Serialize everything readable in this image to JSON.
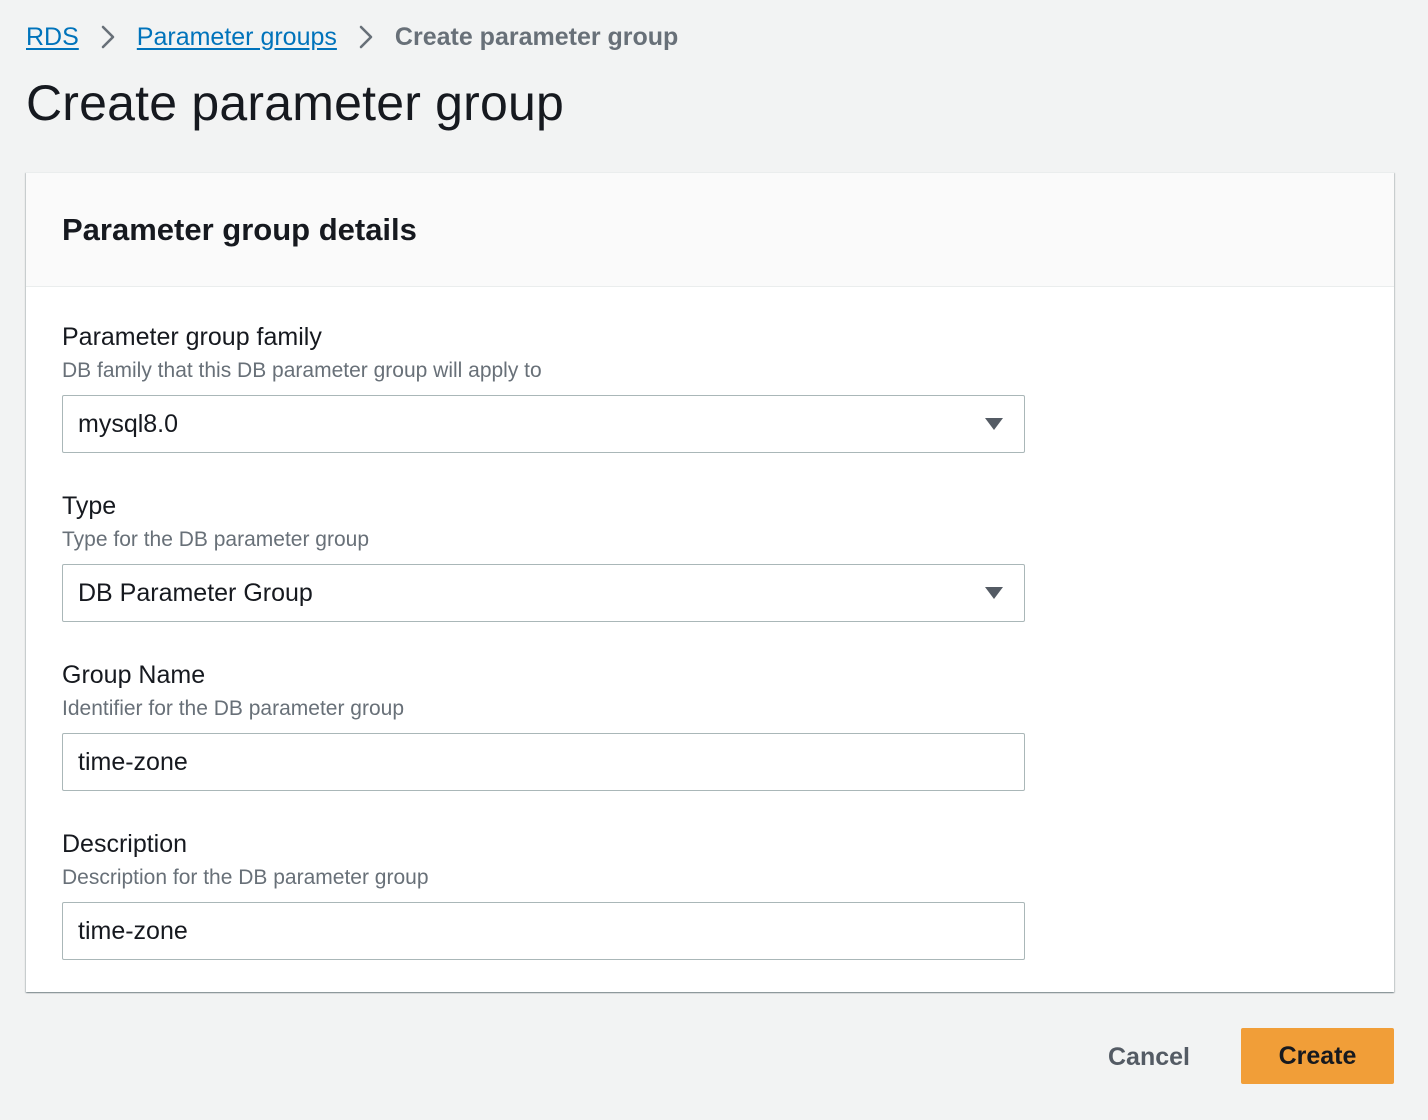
{
  "breadcrumb": {
    "items": [
      {
        "label": "RDS"
      },
      {
        "label": "Parameter groups"
      }
    ],
    "current": "Create parameter group"
  },
  "page": {
    "title": "Create parameter group"
  },
  "panel": {
    "title": "Parameter group details",
    "fields": {
      "family": {
        "label": "Parameter group family",
        "description": "DB family that this DB parameter group will apply to",
        "value": "mysql8.0"
      },
      "type": {
        "label": "Type",
        "description": "Type for the DB parameter group",
        "value": "DB Parameter Group"
      },
      "group_name": {
        "label": "Group Name",
        "description": "Identifier for the DB parameter group",
        "value": "time-zone"
      },
      "description": {
        "label": "Description",
        "description": "Description for the DB parameter group",
        "value": "time-zone"
      }
    }
  },
  "footer": {
    "cancel_label": "Cancel",
    "create_label": "Create"
  },
  "colors": {
    "link": "#0073bb",
    "primary_button": "#f19e38",
    "background": "#f2f3f3"
  },
  "icons": {
    "breadcrumb_separator": "chevron-right-icon",
    "select_caret": "caret-down-icon"
  }
}
